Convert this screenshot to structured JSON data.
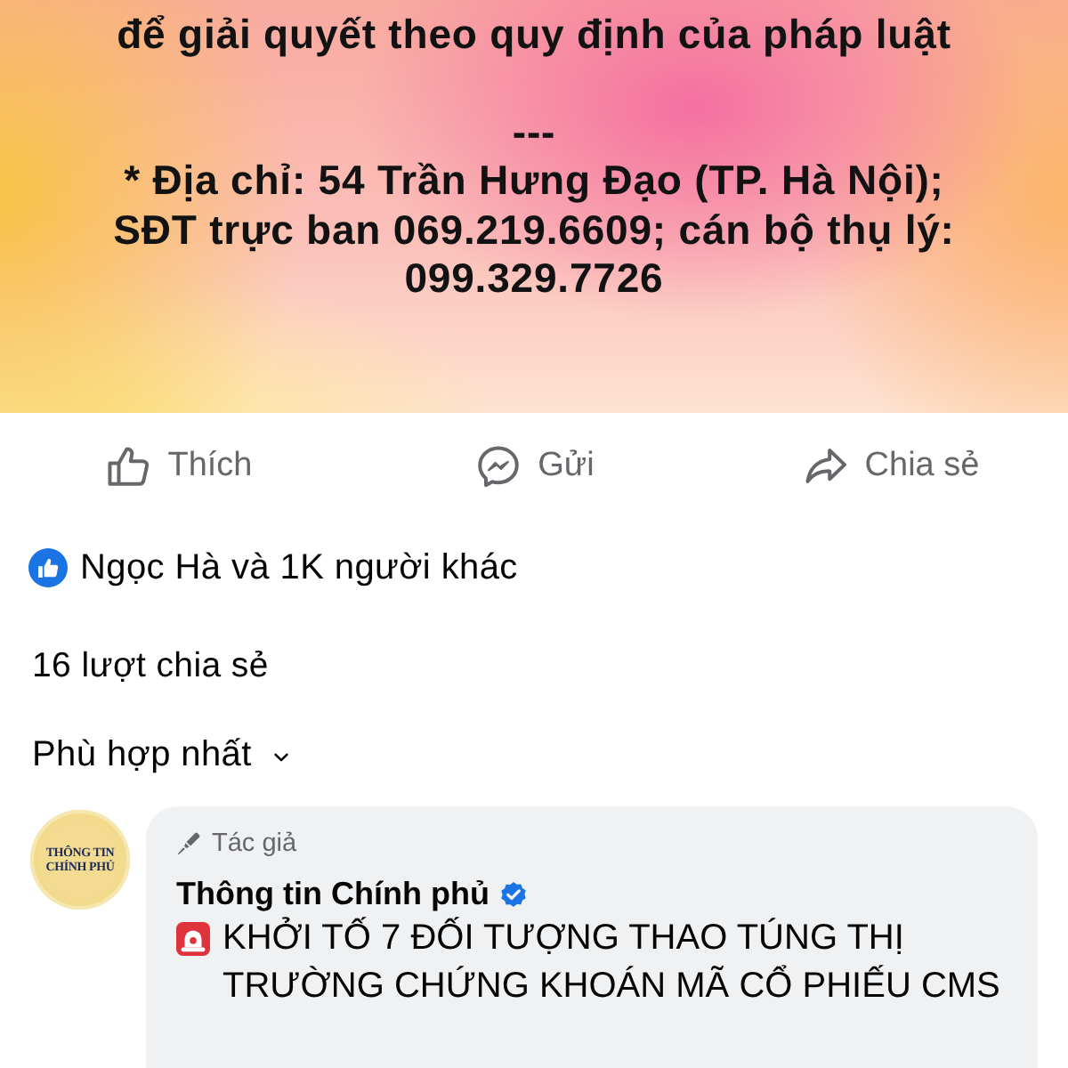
{
  "post": {
    "blocks": [
      {
        "lines": [
          "để giải quyết theo quy định của pháp luật"
        ]
      },
      {
        "lines": [
          "---",
          "* Địa chỉ: 54 Trần Hưng Đạo (TP. Hà Nội);",
          "SĐT trực ban 069.219.6609; cán bộ thụ lý:",
          "099.329.7726"
        ]
      }
    ]
  },
  "actions": [
    {
      "kind": "like",
      "label": "Thích"
    },
    {
      "kind": "send",
      "label": "Gửi"
    },
    {
      "kind": "share",
      "label": "Chia sẻ"
    }
  ],
  "reactions": {
    "summary": "Ngọc Hà và 1K người khác"
  },
  "shares": "16 lượt chia sẻ",
  "sort": {
    "label": "Phù hợp nhất"
  },
  "comments": [
    {
      "avatar_text": [
        "THÔNG TIN",
        "CHÍNH PHỦ"
      ],
      "badge": "Tác giả",
      "author": "Thông tin Chính phủ",
      "verified": true,
      "text": "KHỞI TỐ 7 ĐỐI TƯỢNG THAO TÚNG THỊ TRƯỜNG CHỨNG KHOÁN MÃ CỔ PHIẾU CMS"
    }
  ]
}
